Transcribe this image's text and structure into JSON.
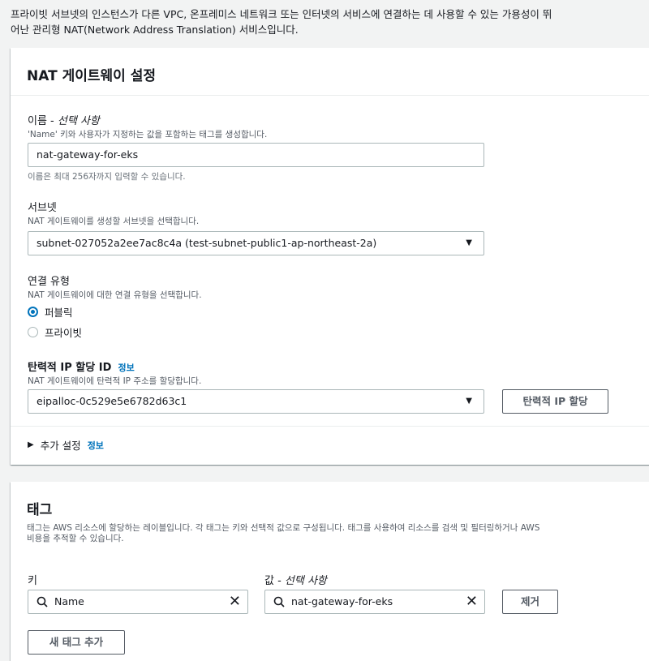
{
  "intro": {
    "line1": "프라이빗 서브넷의 인스턴스가 다른 VPC, 온프레미스 네트워크 또는 인터넷의 서비스에 연결하는 데 사용할 수 있는 가용성이 뛰",
    "line2": "어난 관리형 NAT(Network Address Translation) 서비스입니다."
  },
  "nat_settings": {
    "title": "NAT 게이트웨이 설정",
    "name": {
      "label": "이름 - ",
      "label_optional": "선택 사항",
      "desc": "'Name' 키와 사용자가 지정하는 값을 포함하는 태그를 생성합니다.",
      "value": "nat-gateway-for-eks",
      "hint": "이름은 최대 256자까지 입력할 수 있습니다."
    },
    "subnet": {
      "label": "서브넷",
      "desc": "NAT 게이트웨이를 생성할 서브넷을 선택합니다.",
      "value": "subnet-027052a2ee7ac8c4a (test-subnet-public1-ap-northeast-2a)"
    },
    "connectivity": {
      "label": "연결 유형",
      "desc": "NAT 게이트웨이에 대한 연결 유형을 선택합니다.",
      "options": [
        "퍼블릭",
        "프라이빗"
      ],
      "selected": "퍼블릭"
    },
    "eip": {
      "label": "탄력적 IP 할당 ID",
      "info": "정보",
      "desc": "NAT 게이트웨이에 탄력적 IP 주소를 할당합니다.",
      "value": "eipalloc-0c529e5e6782d63c1",
      "allocate_button": "탄력적 IP 할당"
    },
    "additional": {
      "label": "추가 설정",
      "info": "정보"
    }
  },
  "tags": {
    "title": "태그",
    "desc_line1": "태그는 AWS 리소스에 할당하는 레이블입니다. 각 태그는 키와 선택적 값으로 구성됩니다. 태그를 사용하여 리소스를 검색 및 필터링하거나 AWS",
    "desc_line2": "비용을 추적할 수 있습니다.",
    "key_label": "키",
    "value_label": "값 - ",
    "value_optional": "선택 사항",
    "key_value": "Name",
    "value_value": "nat-gateway-for-eks",
    "remove_button": "제거",
    "add_button": "새 태그 추가"
  },
  "colors": {
    "accent": "#0073bb",
    "border": "#aab7b8",
    "text": "#16191f"
  },
  "icons": [
    "search-icon",
    "clear-icon",
    "caret-down-icon",
    "caret-right-icon",
    "radio-icon"
  ]
}
